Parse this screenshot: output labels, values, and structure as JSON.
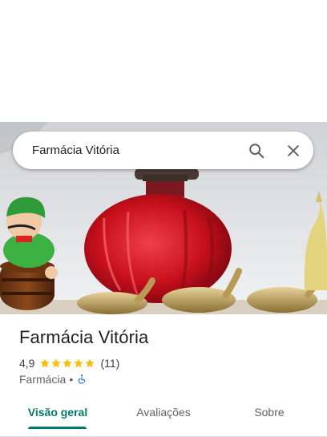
{
  "search": {
    "query": "Farmácia Vitória",
    "search_icon": "search-icon",
    "close_icon": "close-icon"
  },
  "place": {
    "name": "Farmácia Vitória",
    "rating": "4,9",
    "stars": 5,
    "review_count": "(11)",
    "category": "Farmácia",
    "separator": "•",
    "accessibility_icon": "wheelchair-icon"
  },
  "tabs": [
    {
      "label": "Visão geral",
      "active": true
    },
    {
      "label": "Avaliações",
      "active": false
    },
    {
      "label": "Sobre",
      "active": false
    }
  ],
  "colors": {
    "accent": "#00796b",
    "star": "#fbbc04",
    "accessibility": "#1a73e8"
  }
}
